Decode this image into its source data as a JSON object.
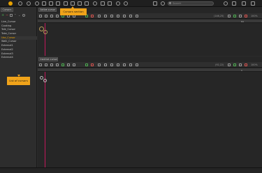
{
  "toolbar": {
    "search_placeholder": "Search"
  },
  "sidebar": {
    "tab_label": "Cursors",
    "items": [
      {
        "label": "Live_Cursor"
      },
      {
        "label": "Cooking"
      },
      {
        "label": "Talk_Cursor"
      },
      {
        "label": "Take_Cursor"
      },
      {
        "label": "Use_Cursor"
      },
      {
        "label": "Walk_Cursor"
      },
      {
        "label": "External1"
      },
      {
        "label": "External2"
      },
      {
        "label": "External3"
      },
      {
        "label": "External4"
      }
    ],
    "selected_index": 4
  },
  "panels": {
    "top": {
      "tab_label": "Active cursor",
      "coords": "(146,25)",
      "zoom": "100%",
      "ruler_end": "64"
    },
    "bottom": {
      "tab_label": "Inactive cursor",
      "coords": "(92,22)",
      "zoom": "100%",
      "ruler_end": "1"
    }
  },
  "callouts": {
    "cursors_section": "Cursors section",
    "list_of_cursors": "List of cursors"
  },
  "colors": {
    "accent": "#f0a31a",
    "selected_item": "#e8a100",
    "timeline_marker": "#c2185b",
    "add_icon": "#4caf50",
    "remove_icon": "#d9534f"
  }
}
